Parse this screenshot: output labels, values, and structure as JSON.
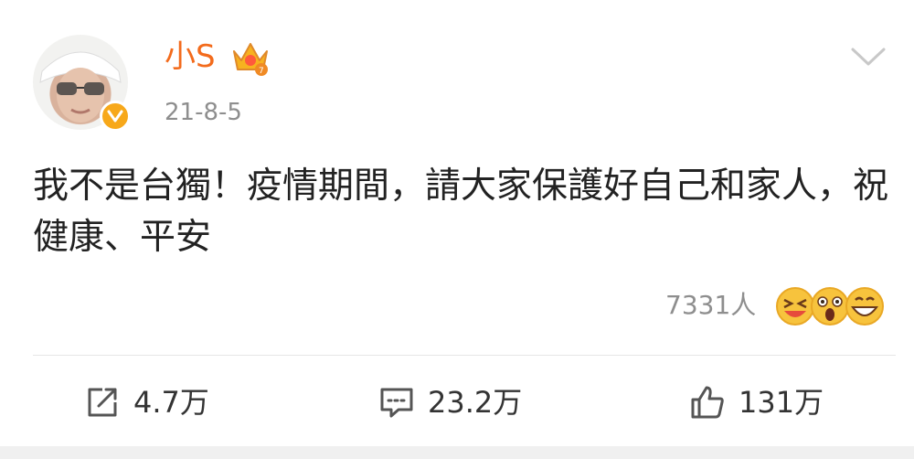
{
  "post": {
    "author": {
      "name": "小S"
    },
    "date": "21-8-5",
    "content": "我不是台獨！疫情期間，請大家保護好自己和家人，祝 健康、平安",
    "reactions": {
      "count_label": "7331人",
      "emojis": [
        "laughing-face-icon",
        "surprised-face-icon",
        "grinning-face-icon"
      ]
    },
    "actions": {
      "reposts": "4.7万",
      "comments": "23.2万",
      "likes": "131万"
    }
  },
  "colors": {
    "username": "#f36b1c",
    "meta_gray": "#8e8e8e",
    "text": "#222222",
    "badge": "#f7a81a"
  }
}
